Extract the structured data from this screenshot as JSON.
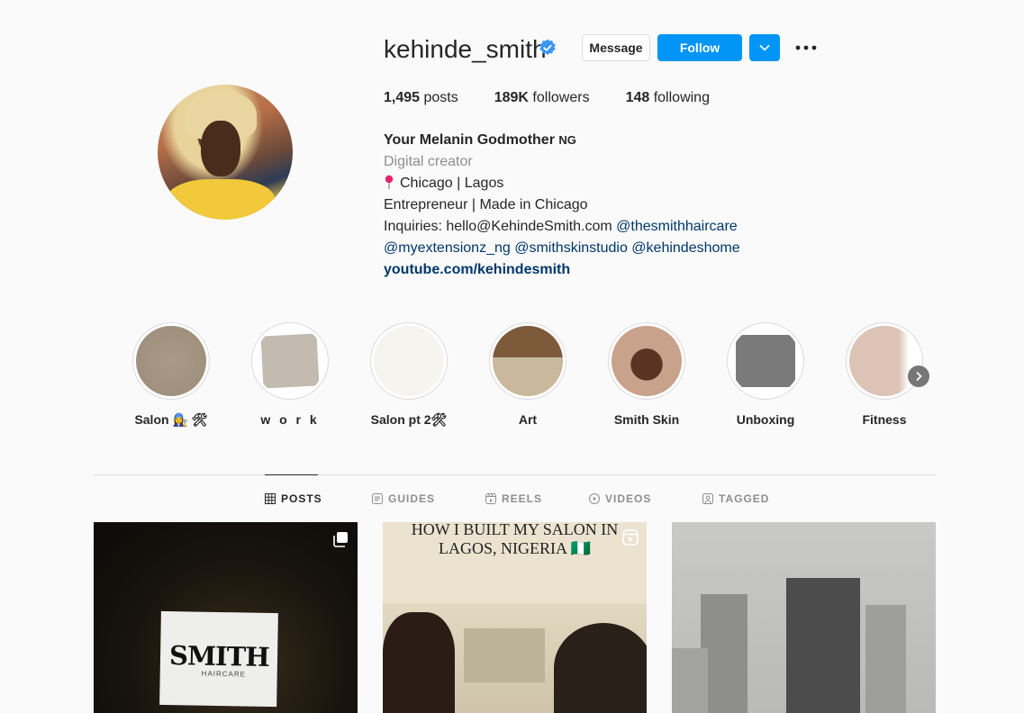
{
  "profile": {
    "username": "kehinde_smith",
    "verified": true,
    "buttons": {
      "message": "Message",
      "follow": "Follow"
    },
    "stats": {
      "posts_count": "1,495",
      "posts_label": " posts",
      "followers_count": "189K",
      "followers_label": " followers",
      "following_count": "148",
      "following_label": " following"
    },
    "bio": {
      "name": "Your Melanin Godmother",
      "name_suffix": "NG",
      "category": "Digital creator",
      "location": "Chicago | Lagos",
      "line1": "Entrepreneur | Made in Chicago",
      "inquiries_prefix": "Inquiries: hello@KehindeSmith.com ",
      "mention1": "@thesmithhaircare",
      "mention2": "@myextensionz_ng",
      "mention3": "@smithskinstudio",
      "mention4": "@kehindeshome",
      "website": "youtube.com/kehindesmith"
    }
  },
  "highlights": [
    {
      "label": "Salon 👩‍🔧 🛠",
      "color": "#a99a88"
    },
    {
      "label": "w o r k",
      "color": "#c4bbb0"
    },
    {
      "label": "Salon pt 2🛠",
      "color": "#f6f4ef"
    },
    {
      "label": "Art",
      "color": "#8a6a48"
    },
    {
      "label": "Smith Skin",
      "color": "#b98f78"
    },
    {
      "label": "Unboxing",
      "color": "#7a7a7a"
    },
    {
      "label": "Fitness",
      "color": "#dcc3b5"
    }
  ],
  "tabs": [
    {
      "label": "POSTS",
      "icon": "grid-icon",
      "active": true
    },
    {
      "label": "GUIDES",
      "icon": "guides-icon",
      "active": false
    },
    {
      "label": "REELS",
      "icon": "reels-icon",
      "active": false
    },
    {
      "label": "VIDEOS",
      "icon": "video-icon",
      "active": false
    },
    {
      "label": "TAGGED",
      "icon": "tagged-icon",
      "active": false
    }
  ],
  "posts": [
    {
      "sign_title": "SMITH",
      "sign_sub": "HAIRCARE",
      "overlay": "carousel-icon"
    },
    {
      "headline": "HOW I BUILT  MY SALON IN\nLAGOS, NIGERIA 🇳🇬",
      "overlay": "reel-icon"
    },
    {
      "overlay": ""
    }
  ],
  "colors": {
    "accent": "#0095f6",
    "link": "#00376b",
    "muted": "#8e8e8e"
  }
}
